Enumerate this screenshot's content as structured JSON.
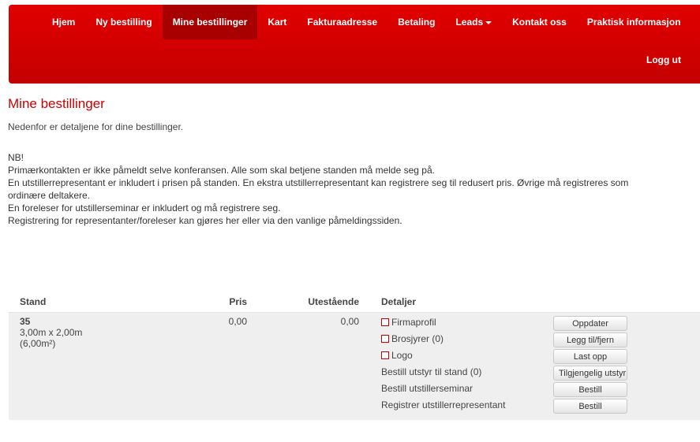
{
  "nav": {
    "items": [
      {
        "label": "Hjem"
      },
      {
        "label": "Ny bestilling"
      },
      {
        "label": "Mine bestillinger"
      },
      {
        "label": "Kart"
      },
      {
        "label": "Fakturaadresse"
      },
      {
        "label": "Betaling"
      },
      {
        "label": "Leads"
      },
      {
        "label": "Kontakt oss"
      },
      {
        "label": "Praktisk informasjon"
      }
    ],
    "active_label": "Mine bestillinger",
    "logout_label": "Logg ut"
  },
  "page": {
    "title": "Mine bestillinger",
    "intro": "Nedenfor er detaljene for dine bestillinger.",
    "notes": [
      "NB!",
      "Primærkontakten er ikke påmeldt selve konferansen. Alle som skal betjene standen må melde seg på.",
      "En utstillerrepresentant er inkludert i prisen på standen. En ekstra utstillerrepresentant kan registrere seg til redusert pris. Øvrige må registreres som",
      "ordinære deltakere.",
      "En foreleser for utstillerseminar er inkludert og må registrere seg.",
      "Registrering for representanter/foreleser kan gjøres her eller via den vanlige påmeldingssiden."
    ]
  },
  "table": {
    "headers": {
      "stand": "Stand",
      "price": "Pris",
      "outstanding": "Utestående",
      "details": "Detaljer"
    },
    "row": {
      "stand": "35",
      "size": "3,00m x 2,00m",
      "area": "(6,00m²)",
      "price": "0,00",
      "outstanding": "0,00",
      "details": [
        {
          "label": "Firmaprofil",
          "checkbox": true,
          "button": "Oppdater"
        },
        {
          "label": "Brosjyrer (0)",
          "checkbox": true,
          "button": "Legg til/fjern"
        },
        {
          "label": "Logo",
          "checkbox": true,
          "button": "Last opp"
        },
        {
          "label": "Bestill utstyr til stand (0)",
          "checkbox": false,
          "button": "Tilgjengelig utstyr"
        },
        {
          "label": "Bestill utstillerseminar",
          "checkbox": false,
          "button": "Bestill"
        },
        {
          "label": "Registrer utstillerrepresentant",
          "checkbox": false,
          "button": "Bestill"
        }
      ]
    }
  },
  "colors": {
    "brand_red": "#cc0000",
    "navbar_top": "#e10000",
    "navbar_bottom": "#c40000",
    "nav_active": "#a80000",
    "row_bg": "#efefef"
  }
}
